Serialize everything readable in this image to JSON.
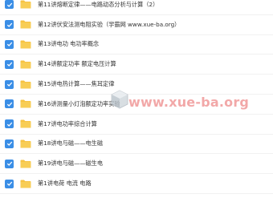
{
  "file_list": {
    "items": [
      {
        "label": "第11讲熔断定律——电路动态分析与计算（2）",
        "checked": true
      },
      {
        "label": "第12讲伏安法测电阻实验（学霸网 www.xue-ba.org）",
        "checked": true
      },
      {
        "label": "第13讲电功 电功率概念",
        "checked": true
      },
      {
        "label": "第14讲额定功率 额定电压计算",
        "checked": true
      },
      {
        "label": "第15讲电热计算——焦耳定律",
        "checked": true
      },
      {
        "label": "第16讲测量小灯泡额定功率实验",
        "checked": true
      },
      {
        "label": "第17讲电功率综合计算",
        "checked": true
      },
      {
        "label": "第18讲电与磁——电生磁",
        "checked": true
      },
      {
        "label": "第19讲电与磁——磁生电",
        "checked": true
      },
      {
        "label": "第1讲电荷 电流 电路",
        "checked": true
      }
    ]
  },
  "watermark": {
    "text": "www.xue-ba.org",
    "logo": "xue-ba-logo"
  },
  "colors": {
    "checkbox": "#3a8ee6",
    "folder": "#f6c343",
    "folder_tab": "#e9b232",
    "watermark": "#e86060"
  }
}
